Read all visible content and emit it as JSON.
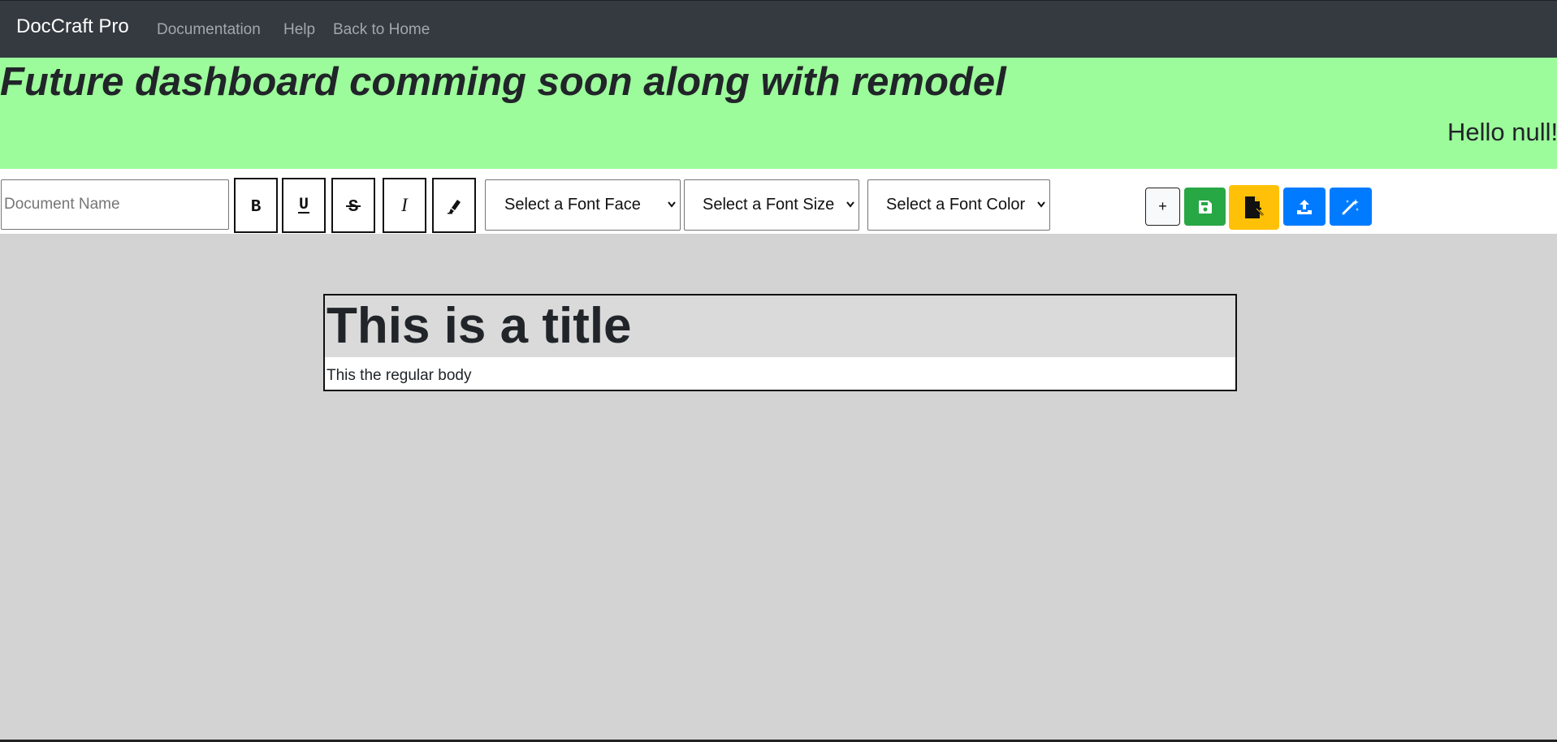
{
  "navbar": {
    "brand": "DocCraft Pro",
    "links": [
      "Documentation",
      "Help",
      "Back to Home"
    ]
  },
  "banner": {
    "title": "Future dashboard comming soon along with remodel",
    "greeting": "Hello null!"
  },
  "toolbar": {
    "document_name": {
      "placeholder": "Document Name",
      "value": ""
    },
    "format_buttons": [
      {
        "name": "bold",
        "icon": "bold-icon",
        "glyph": "B"
      },
      {
        "name": "underline",
        "icon": "underline-icon",
        "glyph": "U"
      },
      {
        "name": "strikethrough",
        "icon": "strikethrough-icon",
        "glyph": "S"
      },
      {
        "name": "italic",
        "icon": "italic-icon",
        "glyph": "I"
      },
      {
        "name": "highlight",
        "icon": "highlighter-icon",
        "glyph": ""
      }
    ],
    "selects": {
      "font_face": "Select a Font Face",
      "font_size": "Select a Font Size",
      "font_color": "Select a Font Color"
    },
    "actions": [
      {
        "name": "add",
        "icon": "plus-icon",
        "label": "+",
        "color": "#f8f9fa"
      },
      {
        "name": "save",
        "icon": "floppy-disk-icon",
        "color": "#28a745"
      },
      {
        "name": "export",
        "icon": "file-export-icon",
        "color": "#ffc107"
      },
      {
        "name": "upload",
        "icon": "upload-icon",
        "color": "#007bff"
      },
      {
        "name": "magic",
        "icon": "magic-wand-icon",
        "color": "#007bff"
      }
    ]
  },
  "document": {
    "title": "This is a title",
    "body": "This the regular body"
  },
  "colors": {
    "navbar": "#343a40",
    "banner": "#9cfb9a",
    "workspace": "#d3d3d3",
    "title_block": "#dadada"
  }
}
